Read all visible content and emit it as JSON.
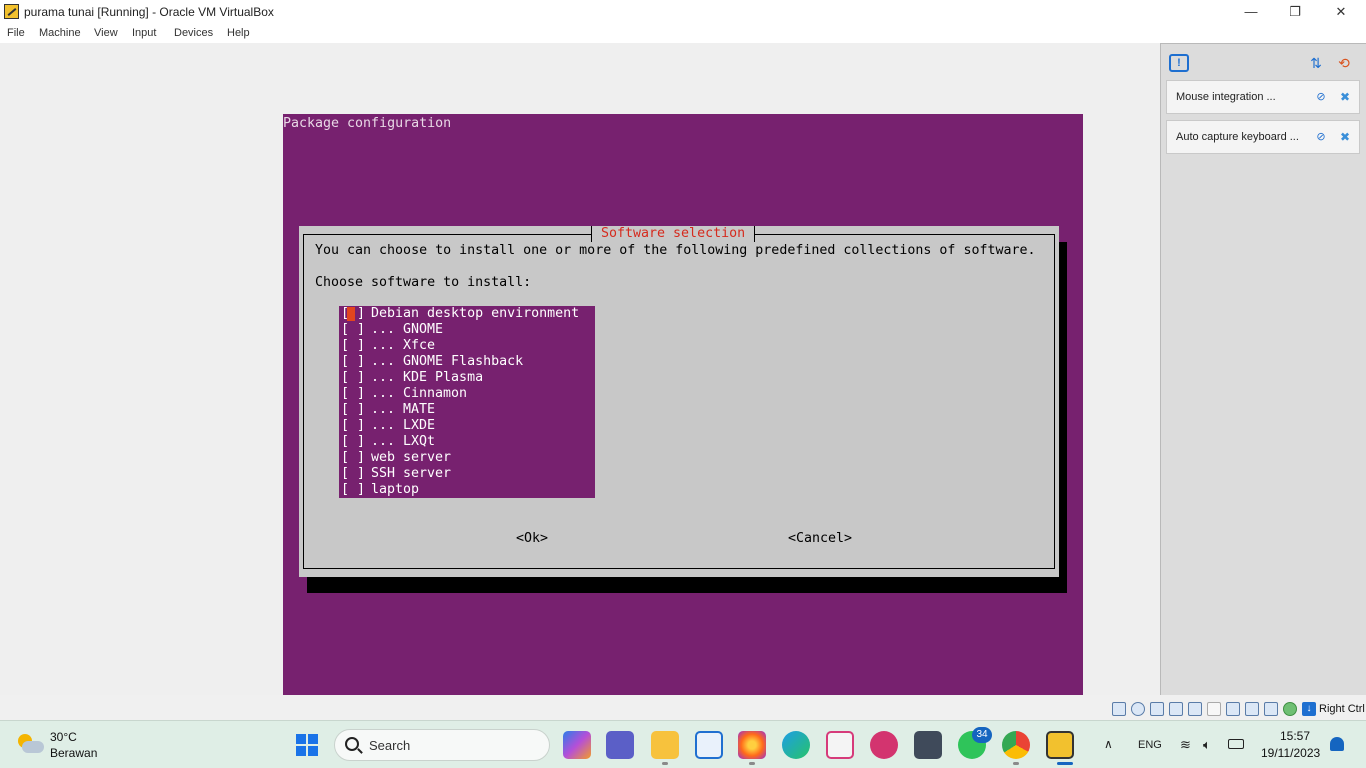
{
  "window": {
    "title": "purama tunai [Running] - Oracle VM VirtualBox",
    "min_glyph": "—",
    "max_glyph": "❐",
    "close_glyph": "✕"
  },
  "menu": [
    "File",
    "Machine",
    "View",
    "Input",
    "Devices",
    "Help"
  ],
  "vm": {
    "header": "Package configuration",
    "dialog": {
      "title": "Software selection",
      "intro": "You can choose to install one or more of the following predefined collections of software.",
      "prompt": "Choose software to install:",
      "checkbox": "[ ]",
      "items": [
        "Debian desktop environment",
        "... GNOME",
        "... Xfce",
        "... GNOME Flashback",
        "... KDE Plasma",
        "... Cinnamon",
        "... MATE",
        "... LXDE",
        "... LXQt",
        "web server",
        "SSH server",
        "laptop"
      ],
      "ok": "<Ok>",
      "cancel": "<Cancel>"
    },
    "colors": {
      "screen": "#77216f",
      "dialog": "#c8c8c8",
      "title": "#d52b1e",
      "cursor": "#e2451e"
    }
  },
  "notifications": {
    "toggle_glyph": "!",
    "sort_glyph": "⇅",
    "clear_glyph": "⟲",
    "items": [
      {
        "text": "Mouse integration ...",
        "mute": "⊘",
        "close": "✖"
      },
      {
        "text": "Auto capture keyboard ...",
        "mute": "⊘",
        "close": "✖"
      }
    ]
  },
  "statusbar": {
    "host_key": "Right Ctrl",
    "host_key_glyph": "↓",
    "icons": [
      "hard-disk-icon",
      "optical-drive-icon",
      "audio-icon",
      "network-icon",
      "usb-icon",
      "shared-folders-icon",
      "display-icon",
      "recording-icon",
      "cpu-icon",
      "mouse-integration-icon"
    ]
  },
  "taskbar": {
    "weather": {
      "temp": "30°C",
      "desc": "Berawan"
    },
    "search_label": "Search",
    "apps": [
      "copilot-icon",
      "teams-icon",
      "file-explorer-icon",
      "vscode-icon",
      "firefox-icon",
      "edge-icon",
      "snipping-tool-icon",
      "wps-icon",
      "virtualbox-icon",
      "whatsapp-icon",
      "chrome-icon",
      "virtualbox-vm-icon"
    ],
    "whatsapp_badge": "34",
    "tray": {
      "chevron": "∧",
      "lang": "ENG",
      "wifi_glyph": "≋",
      "volume_glyph": "🔈︎",
      "time": "15:57",
      "date": "19/11/2023"
    }
  }
}
